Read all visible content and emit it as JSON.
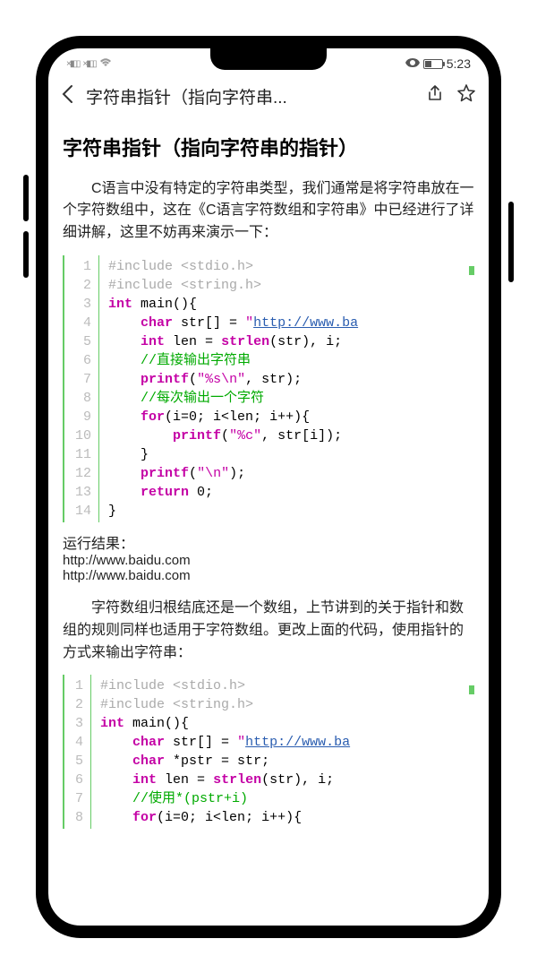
{
  "status": {
    "time": "5:23"
  },
  "nav": {
    "title": "字符串指针（指向字符串..."
  },
  "article": {
    "title": "字符串指针（指向字符串的指针）",
    "para1": "C语言中没有特定的字符串类型，我们通常是将字符串放在一个字符数组中，这在《C语言字符数组和字符串》中已经进行了详细讲解，这里不妨再来演示一下：",
    "result_label": "运行结果：",
    "result1": "http://www.baidu.com",
    "result2": "http://www.baidu.com",
    "para2": "字符数组归根结底还是一个数组，上节讲到的关于指针和数组的规则同样也适用于字符数组。更改上面的代码，使用指针的方式来输出字符串：",
    "code1": {
      "lines": [
        {
          "n": "1",
          "seg": [
            {
              "c": "c-pp",
              "t": "#include <stdio.h>"
            }
          ]
        },
        {
          "n": "2",
          "seg": [
            {
              "c": "c-pp",
              "t": "#include <string.h>"
            }
          ]
        },
        {
          "n": "3",
          "seg": [
            {
              "c": "c-kw",
              "t": "int"
            },
            {
              "c": "",
              "t": " main(){"
            }
          ]
        },
        {
          "n": "4",
          "seg": [
            {
              "c": "",
              "t": "    "
            },
            {
              "c": "c-kw",
              "t": "char"
            },
            {
              "c": "",
              "t": " str[] = "
            },
            {
              "c": "c-str",
              "t": "\""
            },
            {
              "c": "c-url",
              "t": "http://www.ba"
            }
          ]
        },
        {
          "n": "5",
          "seg": [
            {
              "c": "",
              "t": "    "
            },
            {
              "c": "c-kw",
              "t": "int"
            },
            {
              "c": "",
              "t": " len = "
            },
            {
              "c": "c-fn",
              "t": "strlen"
            },
            {
              "c": "",
              "t": "(str), i;"
            }
          ]
        },
        {
          "n": "6",
          "seg": [
            {
              "c": "",
              "t": "    "
            },
            {
              "c": "c-cmt",
              "t": "//直接输出字符串"
            }
          ]
        },
        {
          "n": "7",
          "seg": [
            {
              "c": "",
              "t": "    "
            },
            {
              "c": "c-fn",
              "t": "printf"
            },
            {
              "c": "",
              "t": "("
            },
            {
              "c": "c-str",
              "t": "\"%s\\n\""
            },
            {
              "c": "",
              "t": ", str);"
            }
          ]
        },
        {
          "n": "8",
          "seg": [
            {
              "c": "",
              "t": "    "
            },
            {
              "c": "c-cmt",
              "t": "//每次输出一个字符"
            }
          ]
        },
        {
          "n": "9",
          "seg": [
            {
              "c": "",
              "t": "    "
            },
            {
              "c": "c-kw",
              "t": "for"
            },
            {
              "c": "",
              "t": "(i=0; i<len; i++){"
            }
          ]
        },
        {
          "n": "10",
          "seg": [
            {
              "c": "",
              "t": "        "
            },
            {
              "c": "c-fn",
              "t": "printf"
            },
            {
              "c": "",
              "t": "("
            },
            {
              "c": "c-str",
              "t": "\"%c\""
            },
            {
              "c": "",
              "t": ", str[i]);"
            }
          ]
        },
        {
          "n": "11",
          "seg": [
            {
              "c": "",
              "t": "    }"
            }
          ]
        },
        {
          "n": "12",
          "seg": [
            {
              "c": "",
              "t": "    "
            },
            {
              "c": "c-fn",
              "t": "printf"
            },
            {
              "c": "",
              "t": "("
            },
            {
              "c": "c-str",
              "t": "\"\\n\""
            },
            {
              "c": "",
              "t": ");"
            }
          ]
        },
        {
          "n": "13",
          "seg": [
            {
              "c": "",
              "t": "    "
            },
            {
              "c": "c-kw",
              "t": "return"
            },
            {
              "c": "",
              "t": " 0;"
            }
          ]
        },
        {
          "n": "14",
          "seg": [
            {
              "c": "",
              "t": "}"
            }
          ]
        }
      ]
    },
    "code2": {
      "lines": [
        {
          "n": "1",
          "seg": [
            {
              "c": "c-pp",
              "t": "#include <stdio.h>"
            }
          ]
        },
        {
          "n": "2",
          "seg": [
            {
              "c": "c-pp",
              "t": "#include <string.h>"
            }
          ]
        },
        {
          "n": "3",
          "seg": [
            {
              "c": "c-kw",
              "t": "int"
            },
            {
              "c": "",
              "t": " main(){"
            }
          ]
        },
        {
          "n": "4",
          "seg": [
            {
              "c": "",
              "t": "    "
            },
            {
              "c": "c-kw",
              "t": "char"
            },
            {
              "c": "",
              "t": " str[] = "
            },
            {
              "c": "c-str",
              "t": "\""
            },
            {
              "c": "c-url",
              "t": "http://www.ba"
            }
          ]
        },
        {
          "n": "5",
          "seg": [
            {
              "c": "",
              "t": "    "
            },
            {
              "c": "c-kw",
              "t": "char"
            },
            {
              "c": "",
              "t": " *pstr = str;"
            }
          ]
        },
        {
          "n": "6",
          "seg": [
            {
              "c": "",
              "t": "    "
            },
            {
              "c": "c-kw",
              "t": "int"
            },
            {
              "c": "",
              "t": " len = "
            },
            {
              "c": "c-fn",
              "t": "strlen"
            },
            {
              "c": "",
              "t": "(str), i;"
            }
          ]
        },
        {
          "n": "7",
          "seg": [
            {
              "c": "",
              "t": "    "
            },
            {
              "c": "c-cmt",
              "t": "//使用*(pstr+i)"
            }
          ]
        },
        {
          "n": "8",
          "seg": [
            {
              "c": "",
              "t": "    "
            },
            {
              "c": "c-kw",
              "t": "for"
            },
            {
              "c": "",
              "t": "(i=0; i<len; i++){"
            }
          ]
        }
      ]
    }
  }
}
